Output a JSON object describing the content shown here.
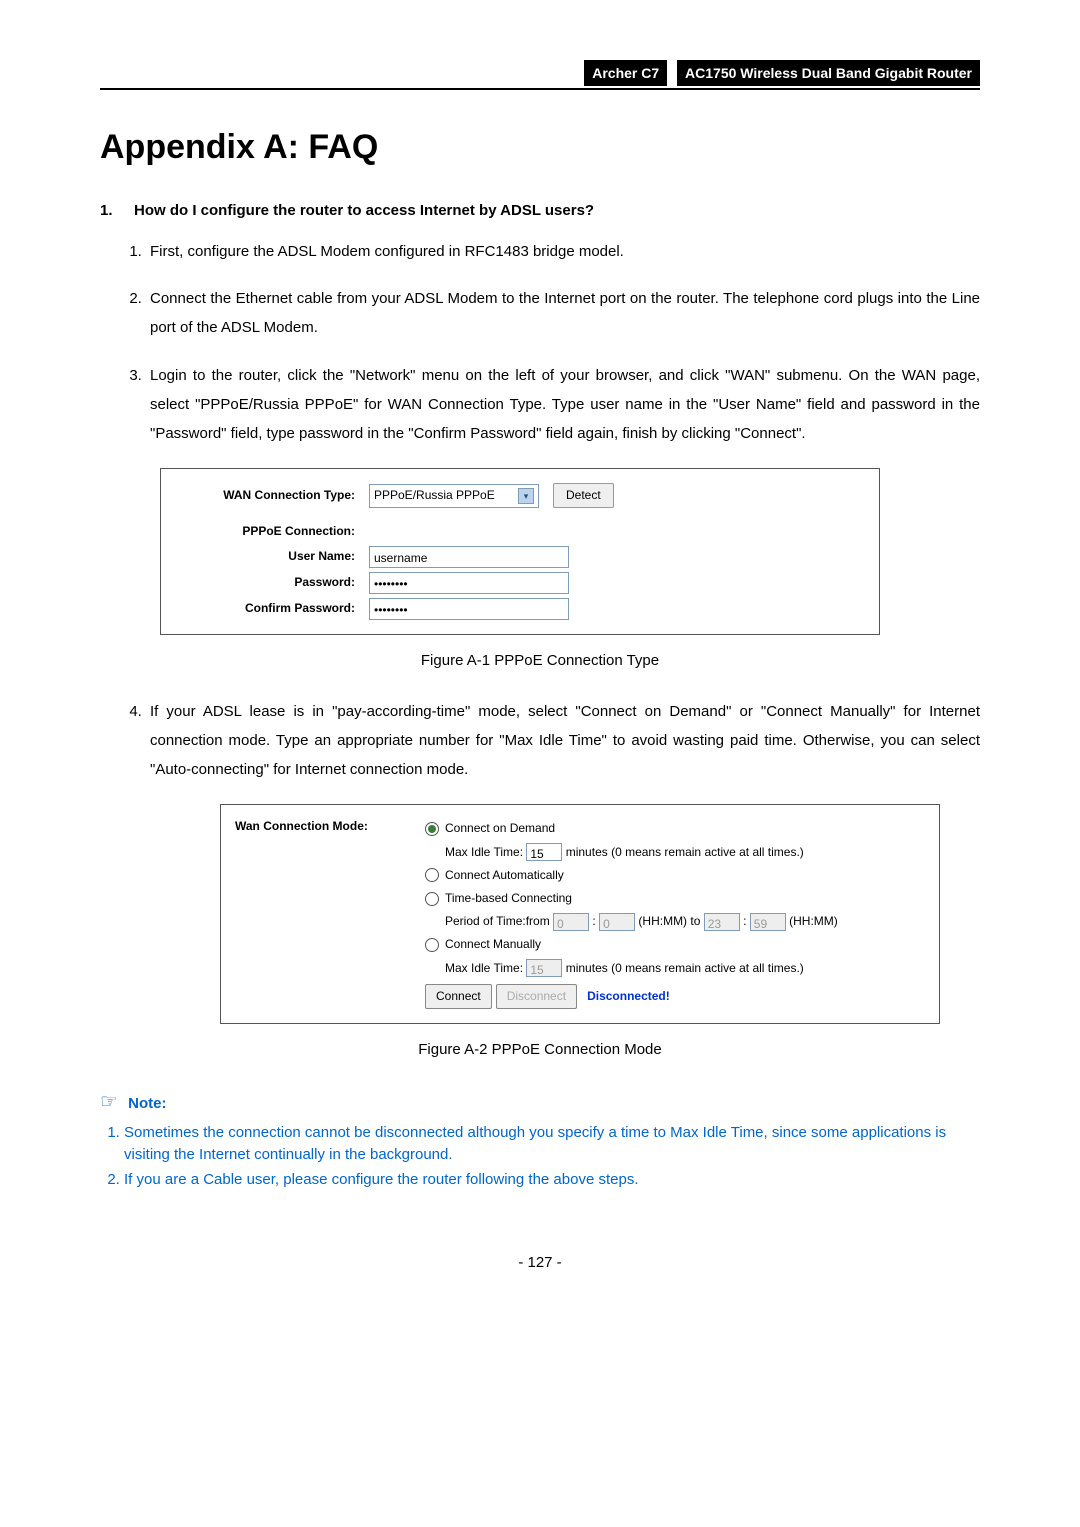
{
  "header": {
    "model": "Archer C7",
    "product": "AC1750 Wireless Dual Band Gigabit Router"
  },
  "title": "Appendix A: FAQ",
  "faq": {
    "number": "1.",
    "question": "How do I configure the router to access Internet by ADSL users?",
    "steps": [
      "First, configure the ADSL Modem configured in RFC1483 bridge model.",
      "Connect the Ethernet cable from your ADSL Modem to the Internet port on the router. The telephone cord plugs into the Line port of the ADSL Modem.",
      "Login to the router, click the \"Network\" menu on the left of your browser, and click \"WAN\" submenu. On the WAN page, select \"PPPoE/Russia PPPoE\" for WAN Connection Type. Type user name in the \"User Name\" field and password in the \"Password\" field, type password in the \"Confirm Password\" field again, finish by clicking \"Connect\".",
      "If your ADSL lease is in \"pay-according-time\" mode, select \"Connect on Demand\" or \"Connect Manually\" for Internet connection mode. Type an appropriate number for \"Max Idle Time\" to avoid wasting paid time. Otherwise, you can select \"Auto-connecting\" for Internet connection mode."
    ]
  },
  "figure1": {
    "labels": {
      "wan_type": "WAN Connection Type:",
      "pppoe_conn": "PPPoE Connection:",
      "user_name": "User Name:",
      "password": "Password:",
      "confirm_password": "Confirm Password:"
    },
    "values": {
      "wan_type_select": "PPPoE/Russia PPPoE",
      "detect_btn": "Detect",
      "user_name": "username",
      "password": "••••••••",
      "confirm_password": "••••••••"
    },
    "caption": "Figure A-1 PPPoE Connection Type"
  },
  "figure2": {
    "label": "Wan Connection Mode:",
    "options": {
      "demand": "Connect on Demand",
      "demand_idle_label": "Max Idle Time:",
      "demand_idle_value": "15",
      "demand_idle_suffix": "minutes (0 means remain active at all times.)",
      "auto": "Connect Automatically",
      "time_based": "Time-based Connecting",
      "period_prefix": "Period of Time:from",
      "period_h1": "0",
      "period_m1": "0",
      "period_mid": "(HH:MM) to",
      "period_h2": "23",
      "period_m2": "59",
      "period_suffix": "(HH:MM)",
      "manual": "Connect Manually",
      "manual_idle_label": "Max Idle Time:",
      "manual_idle_value": "15",
      "manual_idle_suffix": "minutes (0 means remain active at all times.)",
      "connect_btn": "Connect",
      "disconnect_btn": "Disconnect",
      "status": "Disconnected!"
    },
    "caption": "Figure A-2 PPPoE Connection Mode"
  },
  "note": {
    "heading": "Note:",
    "items": [
      "Sometimes the connection cannot be disconnected although you specify a time to Max Idle Time, since some applications is visiting the Internet continually in the background.",
      "If you are a Cable user, please configure the router following the above steps."
    ]
  },
  "page_number": "- 127 -"
}
